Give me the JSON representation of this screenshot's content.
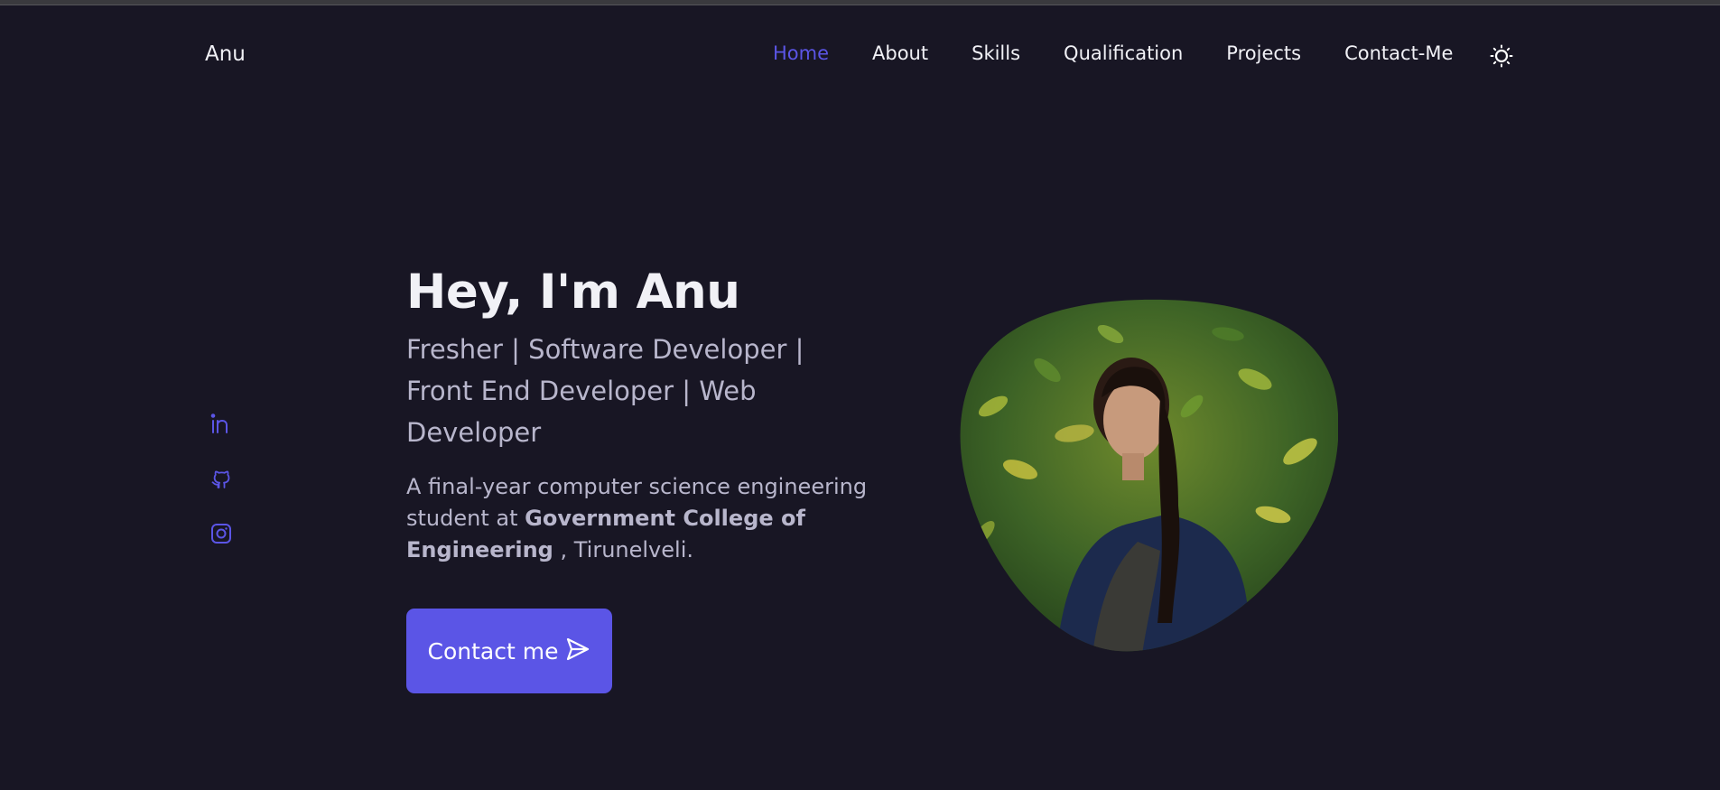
{
  "header": {
    "logo": "Anu",
    "nav": [
      {
        "label": "Home",
        "active": true
      },
      {
        "label": "About"
      },
      {
        "label": "Skills"
      },
      {
        "label": "Qualification"
      },
      {
        "label": "Projects"
      },
      {
        "label": "Contact-Me"
      }
    ],
    "theme_icon": "sun-icon"
  },
  "socials": [
    {
      "icon": "linkedin-icon"
    },
    {
      "icon": "github-icon"
    },
    {
      "icon": "instagram-icon"
    }
  ],
  "hero": {
    "title": "Hey, I'm Anu",
    "subtitle": "Fresher | Software Developer | Front End Developer | Web Developer",
    "desc_start": "A final-year computer science engineering student at ",
    "desc_bold": "Government College of Engineering",
    "desc_end": " , Tirunelveli.",
    "cta_label": "Contact me",
    "cta_icon": "send-icon"
  },
  "colors": {
    "background": "#181624",
    "accent": "#5b55e6",
    "text": "#f1f1f6",
    "muted": "#b8b6cc"
  }
}
